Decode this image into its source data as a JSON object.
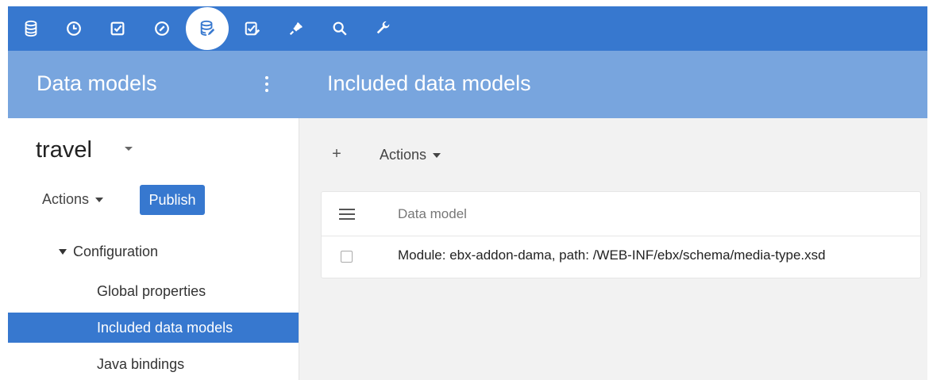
{
  "toolbar": {
    "icons": [
      {
        "name": "database-icon"
      },
      {
        "name": "history-icon"
      },
      {
        "name": "task-checkbox-icon"
      },
      {
        "name": "dashboard-icon"
      },
      {
        "name": "data-model-icon",
        "active": true
      },
      {
        "name": "workflow-icon"
      },
      {
        "name": "plugin-icon"
      },
      {
        "name": "search-icon"
      },
      {
        "name": "wrench-icon"
      }
    ],
    "bar_color": "#3778cf"
  },
  "header": {
    "left_title": "Data models",
    "right_title": "Included data models",
    "band_color": "#78a5de"
  },
  "sidebar": {
    "model_name": "travel",
    "actions_label": "Actions",
    "publish_label": "Publish",
    "tree": {
      "group_label": "Configuration",
      "items": [
        {
          "label": "Global properties"
        },
        {
          "label": "Included data models",
          "selected": true
        },
        {
          "label": "Java bindings"
        }
      ]
    }
  },
  "main": {
    "add_label": "+",
    "actions_label": "Actions",
    "table": {
      "column_header": "Data model",
      "rows": [
        {
          "label": "Module: ebx-addon-dama, path: /WEB-INF/ebx/schema/media-type.xsd",
          "checked": false
        }
      ]
    }
  }
}
